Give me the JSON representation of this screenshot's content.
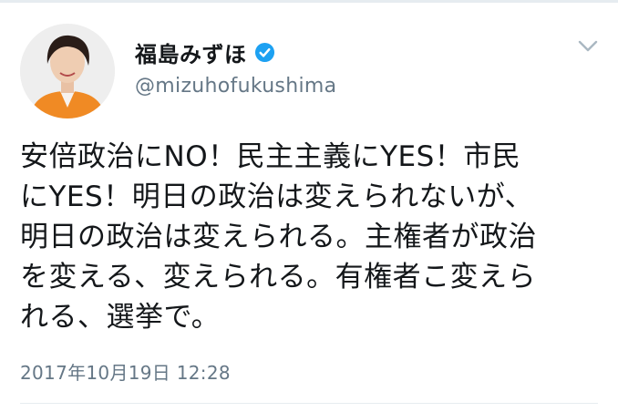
{
  "tweet": {
    "display_name": "福島みずほ",
    "handle": "@mizuhofukushima",
    "verified": true,
    "text_lines": [
      "安倍政治にNO！民主主義にYES！市民",
      "にYES！明日の政治は変えられないが、",
      "明日の政治は変えられる。主権者が政治",
      "を変える、変えられる。有権者こ変えら",
      "れる、選挙で。"
    ],
    "timestamp": "2017年10月19日 12:28"
  },
  "icons": {
    "verified": "verified-badge-icon",
    "menu": "chevron-down-icon"
  },
  "colors": {
    "text": "#14171a",
    "secondary_text": "#657786",
    "verified_blue": "#1da1f2",
    "divider": "#e6ecf0",
    "avatar_jacket": "#f08a24"
  }
}
